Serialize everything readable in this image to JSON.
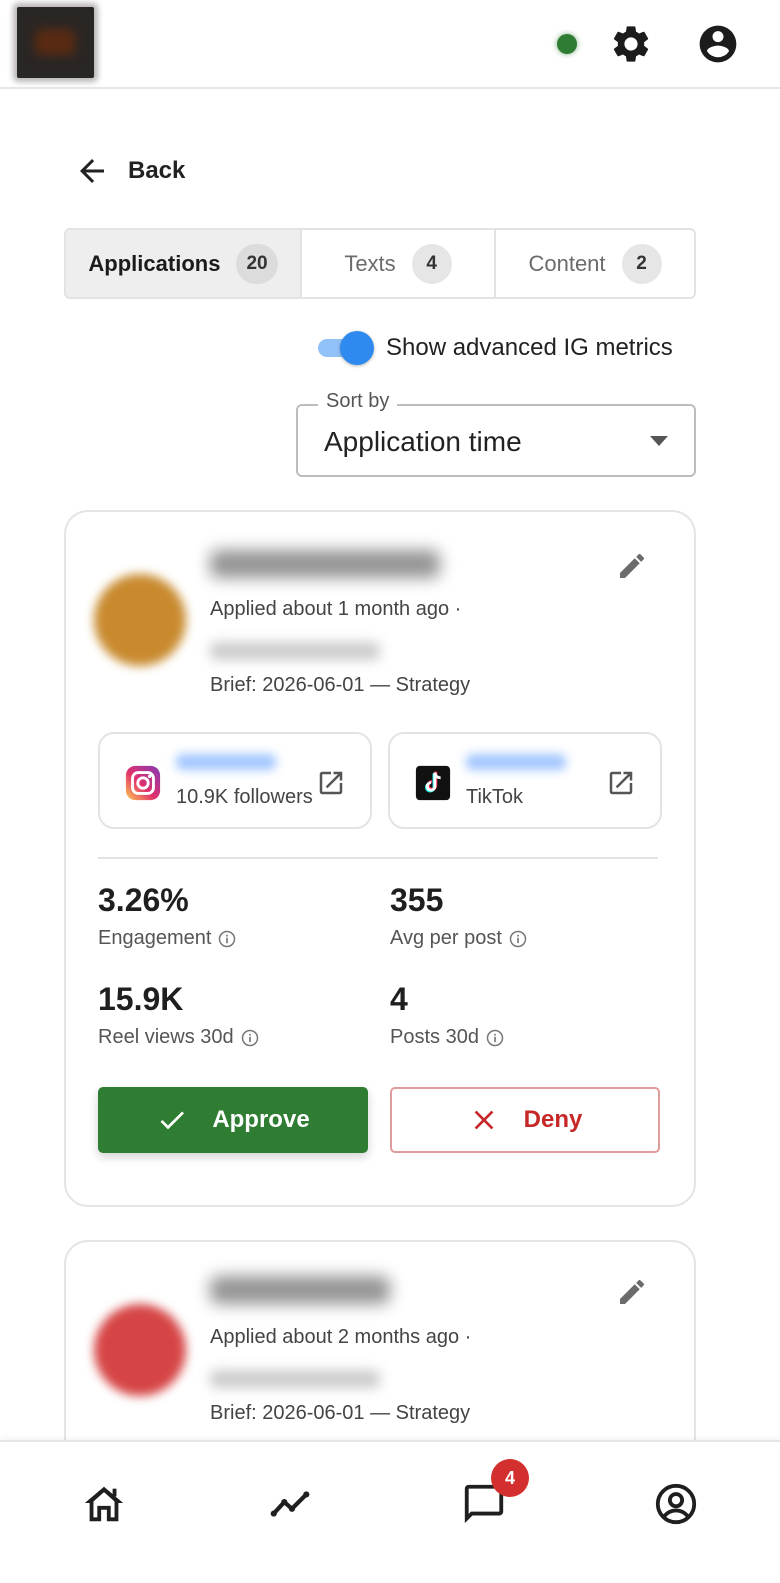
{
  "header": {
    "status_color": "#2e7d32",
    "icons": [
      "settings-icon",
      "account-circle-icon"
    ]
  },
  "back": {
    "label": "Back"
  },
  "tabs": [
    {
      "label": "Applications",
      "count": "20",
      "active": true
    },
    {
      "label": "Texts",
      "count": "4",
      "active": false
    },
    {
      "label": "Content",
      "count": "2",
      "active": false
    }
  ],
  "toggle": {
    "label": "Show advanced IG metrics",
    "on": true
  },
  "sort": {
    "legend": "Sort by",
    "value": "Application time"
  },
  "cards": [
    {
      "applied": "Applied about 1 month ago ·",
      "brief": "Brief: 2026-06-01 — Strategy",
      "avatar_color": "#c98a2e",
      "socials": [
        {
          "platform": "instagram",
          "sub": "10.9K followers"
        },
        {
          "platform": "tiktok",
          "sub": "TikTok"
        }
      ],
      "metrics": [
        {
          "value": "3.26%",
          "label": "Engagement"
        },
        {
          "value": "355",
          "label": "Avg per post"
        },
        {
          "value": "15.9K",
          "label": "Reel views 30d"
        },
        {
          "value": "4",
          "label": "Posts 30d"
        }
      ],
      "actions": {
        "approve": "Approve",
        "deny": "Deny"
      }
    },
    {
      "applied": "Applied about 2 months ago ·",
      "brief": "Brief: 2026-06-01 — Strategy",
      "avatar_color": "#d64545"
    }
  ],
  "bottom_nav": {
    "items": [
      "home-icon",
      "analytics-icon",
      "chat-icon",
      "profile-icon"
    ],
    "chat_badge": "4",
    "badge_color": "#d32f2f"
  },
  "colors": {
    "accent": "#2f8af0",
    "approve": "#2e7d32",
    "deny": "#c62828"
  }
}
